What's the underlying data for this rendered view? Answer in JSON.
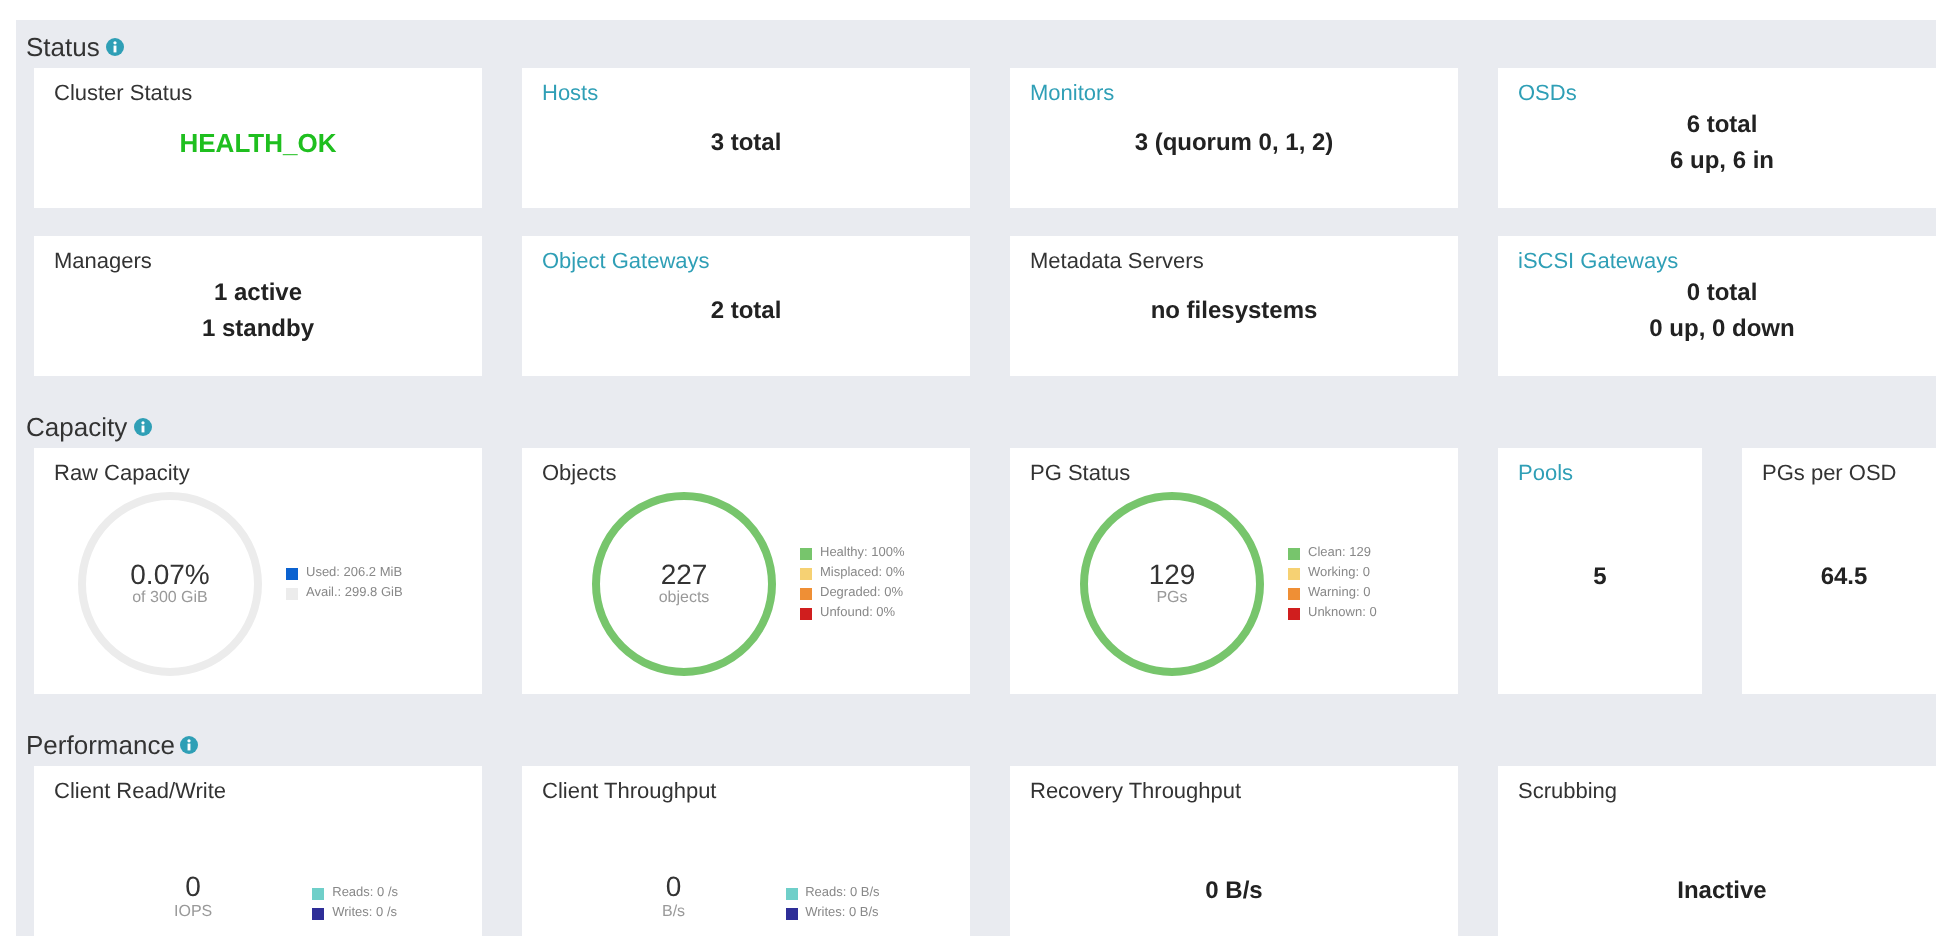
{
  "sections": [
    {
      "title": "Status",
      "rows": [
        [
          {
            "kind": "lines",
            "title": "Cluster Status",
            "link": false,
            "lines": [
              "HEALTH_OK"
            ],
            "healthy": true
          },
          {
            "kind": "lines",
            "title": "Hosts",
            "link": true,
            "lines": [
              "3 total"
            ]
          },
          {
            "kind": "lines",
            "title": "Monitors",
            "link": true,
            "lines": [
              "3 (quorum 0, 1, 2)"
            ]
          },
          {
            "kind": "lines",
            "title": "OSDs",
            "link": true,
            "lines": [
              "6 total",
              "6 up, 6 in"
            ]
          }
        ],
        [
          {
            "kind": "lines",
            "title": "Managers",
            "link": false,
            "lines": [
              "1 active",
              "1 standby"
            ]
          },
          {
            "kind": "lines",
            "title": "Object Gateways",
            "link": true,
            "lines": [
              "2 total"
            ]
          },
          {
            "kind": "lines",
            "title": "Metadata Servers",
            "link": false,
            "lines": [
              "no filesystems"
            ]
          },
          {
            "kind": "lines",
            "title": "iSCSI Gateways",
            "link": true,
            "lines": [
              "0 total",
              "0 up, 0 down"
            ]
          }
        ]
      ]
    },
    {
      "title": "Capacity",
      "rows": [
        [
          {
            "kind": "donut",
            "title": "Raw Capacity",
            "link": false,
            "value": "0.07%",
            "unit": "of 300 GiB",
            "color": "#ececec",
            "legend": [
              {
                "label": "Used: 206.2 MiB",
                "color": "#0b62d0"
              },
              {
                "label": "Avail.: 299.8 GiB",
                "color": "#ececec"
              }
            ]
          },
          {
            "kind": "donut",
            "title": "Objects",
            "link": false,
            "value": "227",
            "unit": "objects",
            "color": "#77c56c",
            "legend": [
              {
                "label": "Healthy: 100%",
                "color": "#77c56c"
              },
              {
                "label": "Misplaced: 0%",
                "color": "#f6d173"
              },
              {
                "label": "Degraded: 0%",
                "color": "#ef8f35"
              },
              {
                "label": "Unfound: 0%",
                "color": "#d01e1e"
              }
            ]
          },
          {
            "kind": "donut",
            "title": "PG Status",
            "link": false,
            "value": "129",
            "unit": "PGs",
            "color": "#77c56c",
            "legend": [
              {
                "label": "Clean: 129",
                "color": "#77c56c"
              },
              {
                "label": "Working: 0",
                "color": "#f6d173"
              },
              {
                "label": "Warning: 0",
                "color": "#ef8f35"
              },
              {
                "label": "Unknown: 0",
                "color": "#d01e1e"
              }
            ]
          },
          {
            "kind": "small",
            "title": "Pools",
            "link": true,
            "lines": [
              "5"
            ]
          },
          {
            "kind": "small",
            "title": "PGs per OSD",
            "link": false,
            "lines": [
              "64.5"
            ]
          }
        ]
      ]
    },
    {
      "title": "Performance",
      "rows": [
        [
          {
            "kind": "metric",
            "title": "Client Read/Write",
            "link": false,
            "value": "0",
            "unit": "IOPS",
            "legend": [
              {
                "label": "Reads: 0 /s",
                "color": "#6fcfc9"
              },
              {
                "label": "Writes: 0 /s",
                "color": "#2e2e98"
              }
            ]
          },
          {
            "kind": "metric",
            "title": "Client Throughput",
            "link": false,
            "value": "0",
            "unit": "B/s",
            "legend": [
              {
                "label": "Reads: 0 B/s",
                "color": "#6fcfc9"
              },
              {
                "label": "Writes: 0 B/s",
                "color": "#2e2e98"
              }
            ]
          },
          {
            "kind": "bottom",
            "title": "Recovery Throughput",
            "link": false,
            "lines": [
              "0 B/s"
            ]
          },
          {
            "kind": "bottom",
            "title": "Scrubbing",
            "link": false,
            "lines": [
              "Inactive"
            ]
          }
        ]
      ]
    }
  ]
}
